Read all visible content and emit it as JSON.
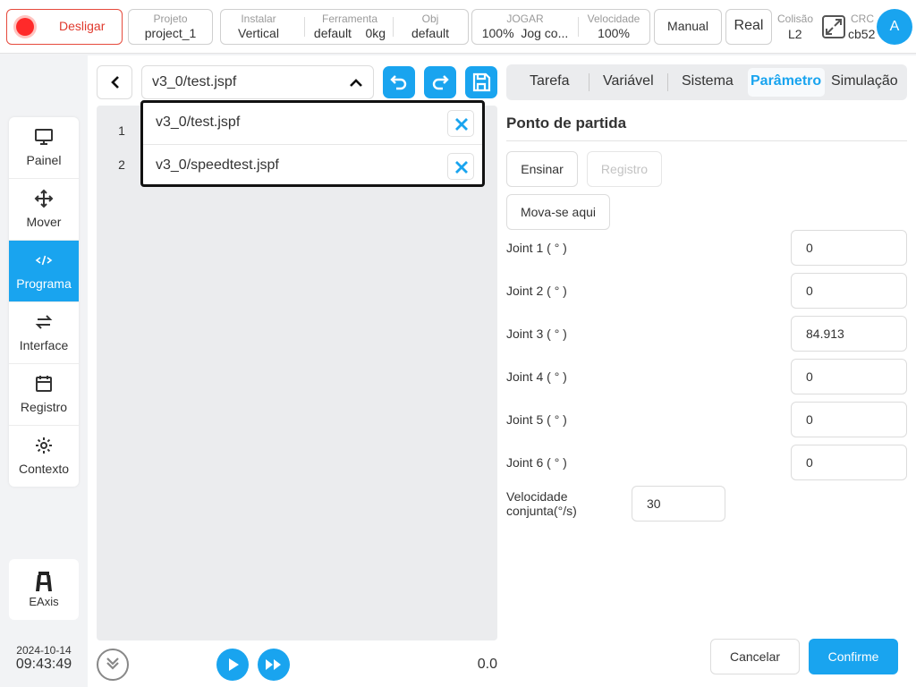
{
  "topbar": {
    "power_button": "Desligar",
    "project": {
      "label": "Projeto",
      "value": "project_1"
    },
    "install": {
      "label": "Instalar",
      "value": "Vertical"
    },
    "tool": {
      "label": "Ferramenta",
      "value": "default",
      "value2": "0kg"
    },
    "obj": {
      "label": "Obj",
      "value": "default"
    },
    "jog": {
      "label": "JOGAR",
      "value": "100%",
      "value2": "Jog co..."
    },
    "speed": {
      "label": "Velocidade",
      "value": "100%"
    },
    "mode_button": "Manual",
    "real_button": "Real",
    "collision": {
      "label": "Colisão",
      "value": "L2"
    },
    "crc": {
      "label": "CRC",
      "value": "cb52"
    },
    "avatar": "A"
  },
  "sidebar": {
    "items": [
      {
        "label": "Painel",
        "icon": "monitor-icon"
      },
      {
        "label": "Mover",
        "icon": "move-icon"
      },
      {
        "label": "Programa",
        "icon": "code-icon"
      },
      {
        "label": "Interface",
        "icon": "swap-icon"
      },
      {
        "label": "Registro",
        "icon": "calendar-icon"
      },
      {
        "label": "Contexto",
        "icon": "gear-icon"
      }
    ],
    "active": "Programa",
    "eaxis_label": "EAxis",
    "date": "2024-10-14",
    "time": "09:43:49"
  },
  "editor": {
    "current_file": "v3_0/test.jspf",
    "line_numbers": [
      "1",
      "2"
    ],
    "dropdown_files": [
      "v3_0/test.jspf",
      "v3_0/speedtest.jspf"
    ],
    "speed_value": "0.0"
  },
  "tabs": {
    "items": [
      "Tarefa",
      "Variável",
      "Sistema",
      "Parâmetro",
      "Simulação"
    ],
    "active": "Parâmetro"
  },
  "parameter": {
    "title": "Ponto de partida",
    "teach_button": "Ensinar",
    "record_button": "Registro",
    "move_here_button": "Mova-se aqui",
    "joints": [
      {
        "label": "Joint 1 ( ° )",
        "value": "0"
      },
      {
        "label": "Joint 2 ( ° )",
        "value": "0"
      },
      {
        "label": "Joint 3 ( ° )",
        "value": "84.913"
      },
      {
        "label": "Joint 4 ( ° )",
        "value": "0"
      },
      {
        "label": "Joint 5 ( ° )",
        "value": "0"
      },
      {
        "label": "Joint 6 ( ° )",
        "value": "0"
      }
    ],
    "joint_speed_label": "Velocidade conjunta(°/s)",
    "joint_speed_value": "30",
    "cancel_button": "Cancelar",
    "confirm_button": "Confirme"
  },
  "colors": {
    "accent": "#19a4ef",
    "danger": "#e03a2e"
  }
}
